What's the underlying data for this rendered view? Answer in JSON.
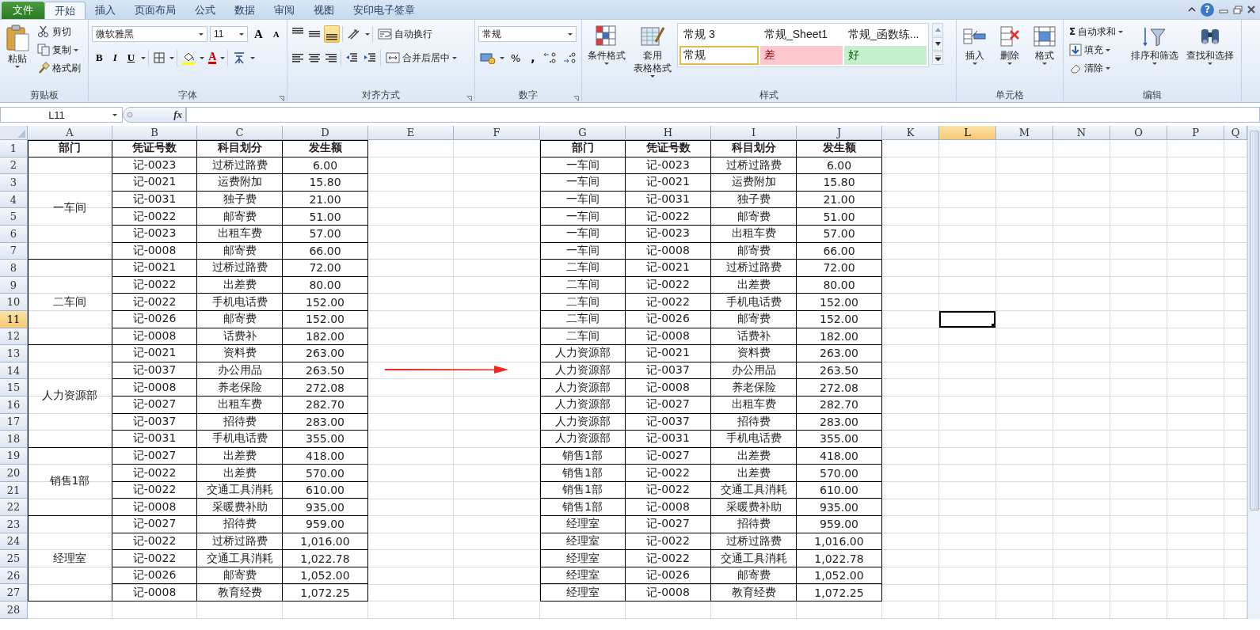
{
  "app_tabs": [
    {
      "label": "文件",
      "kind": "file",
      "selected": false
    },
    {
      "label": "开始",
      "kind": "tab",
      "selected": true
    },
    {
      "label": "插入",
      "kind": "tab",
      "selected": false
    },
    {
      "label": "页面布局",
      "kind": "tab",
      "selected": false
    },
    {
      "label": "公式",
      "kind": "tab",
      "selected": false
    },
    {
      "label": "数据",
      "kind": "tab",
      "selected": false
    },
    {
      "label": "审阅",
      "kind": "tab",
      "selected": false
    },
    {
      "label": "视图",
      "kind": "tab",
      "selected": false
    },
    {
      "label": "安印电子签章",
      "kind": "tab",
      "selected": false
    }
  ],
  "help": "?",
  "ribbon": {
    "clipboard": {
      "paste": "粘贴",
      "cut": "剪切",
      "copy": "复制",
      "format_painter": "格式刷",
      "label": "剪贴板"
    },
    "font": {
      "font_name": "微软雅黑",
      "font_size": "11",
      "grow": "A",
      "shrink": "A",
      "bold": "B",
      "italic": "I",
      "underline": "U",
      "font_color": "A",
      "label": "字体"
    },
    "alignment": {
      "vertical": [
        {
          "kind": "top",
          "selected": false
        },
        {
          "kind": "middle",
          "selected": false
        },
        {
          "kind": "bottom",
          "selected": true
        }
      ],
      "horizontal": [
        {
          "kind": "left",
          "selected": false
        },
        {
          "kind": "center",
          "selected": false
        },
        {
          "kind": "right",
          "selected": false
        }
      ],
      "wrap_text": "自动换行",
      "merge_center": "合并后居中",
      "label": "对齐方式"
    },
    "number": {
      "format": "常规",
      "percent": "%",
      "comma": ",",
      "label": "数字"
    },
    "styles": {
      "conditional": "条件格式",
      "table_format": [
        "套用",
        "表格格式"
      ],
      "gallery": [
        {
          "label": "常规 3",
          "kind": "plain",
          "selected": false
        },
        {
          "label": "常规_Sheet1",
          "kind": "plain",
          "selected": false
        },
        {
          "label": "常规_函数练...",
          "kind": "plain",
          "selected": false
        },
        {
          "label": "常规",
          "kind": "plain",
          "selected": true
        },
        {
          "label": "差",
          "kind": "bad",
          "selected": false
        },
        {
          "label": "好",
          "kind": "good",
          "selected": false
        }
      ],
      "label": "样式"
    },
    "cells": {
      "insert": "插入",
      "delete": "删除",
      "format": "格式",
      "label": "单元格"
    },
    "editing": {
      "sigma": "Σ",
      "autosum": "自动求和",
      "fill": "填充",
      "clear": "清除",
      "sort_filter": "排序和筛选",
      "find_select": "查找和选择",
      "label": "编辑"
    }
  },
  "name_box": "L11",
  "formula_label": "fx",
  "columns": [
    {
      "label": "A",
      "selected": false
    },
    {
      "label": "B",
      "selected": false
    },
    {
      "label": "C",
      "selected": false
    },
    {
      "label": "D",
      "selected": false
    },
    {
      "label": "E",
      "selected": false
    },
    {
      "label": "F",
      "selected": false
    },
    {
      "label": "G",
      "selected": false
    },
    {
      "label": "H",
      "selected": false
    },
    {
      "label": "I",
      "selected": false
    },
    {
      "label": "J",
      "selected": false
    },
    {
      "label": "K",
      "selected": false
    },
    {
      "label": "L",
      "selected": true
    },
    {
      "label": "M",
      "selected": false
    },
    {
      "label": "N",
      "selected": false
    },
    {
      "label": "O",
      "selected": false
    },
    {
      "label": "P",
      "selected": false
    },
    {
      "label": "Q",
      "selected": false
    }
  ],
  "rows": [
    {
      "label": "1",
      "selected": false
    },
    {
      "label": "2",
      "selected": false
    },
    {
      "label": "3",
      "selected": false
    },
    {
      "label": "4",
      "selected": false
    },
    {
      "label": "5",
      "selected": false
    },
    {
      "label": "6",
      "selected": false
    },
    {
      "label": "7",
      "selected": false
    },
    {
      "label": "8",
      "selected": false
    },
    {
      "label": "9",
      "selected": false
    },
    {
      "label": "10",
      "selected": false
    },
    {
      "label": "11",
      "selected": true
    },
    {
      "label": "12",
      "selected": false
    },
    {
      "label": "13",
      "selected": false
    },
    {
      "label": "14",
      "selected": false
    },
    {
      "label": "15",
      "selected": false
    },
    {
      "label": "16",
      "selected": false
    },
    {
      "label": "17",
      "selected": false
    },
    {
      "label": "18",
      "selected": false
    },
    {
      "label": "19",
      "selected": false
    },
    {
      "label": "20",
      "selected": false
    },
    {
      "label": "21",
      "selected": false
    },
    {
      "label": "22",
      "selected": false
    },
    {
      "label": "23",
      "selected": false
    },
    {
      "label": "24",
      "selected": false
    },
    {
      "label": "25",
      "selected": false
    },
    {
      "label": "26",
      "selected": false
    },
    {
      "label": "27",
      "selected": false
    },
    {
      "label": "28",
      "selected": false
    }
  ],
  "left_table": {
    "header": [
      "部门",
      "凭证号数",
      "科目划分",
      "发生额"
    ],
    "groups": [
      {
        "department": "一车间",
        "rows": [
          [
            "记-0023",
            "过桥过路费",
            "6.00"
          ],
          [
            "记-0021",
            "运费附加",
            "15.80"
          ],
          [
            "记-0031",
            "独子费",
            "21.00"
          ],
          [
            "记-0022",
            "邮寄费",
            "51.00"
          ],
          [
            "记-0023",
            "出租车费",
            "57.00"
          ],
          [
            "记-0008",
            "邮寄费",
            "66.00"
          ]
        ]
      },
      {
        "department": "二车间",
        "rows": [
          [
            "记-0021",
            "过桥过路费",
            "72.00"
          ],
          [
            "记-0022",
            "出差费",
            "80.00"
          ],
          [
            "记-0022",
            "手机电话费",
            "152.00"
          ],
          [
            "记-0026",
            "邮寄费",
            "152.00"
          ],
          [
            "记-0008",
            "话费补",
            "182.00"
          ]
        ]
      },
      {
        "department": "人力资源部",
        "rows": [
          [
            "记-0021",
            "资料费",
            "263.00"
          ],
          [
            "记-0037",
            "办公用品",
            "263.50"
          ],
          [
            "记-0008",
            "养老保险",
            "272.08"
          ],
          [
            "记-0027",
            "出租车费",
            "282.70"
          ],
          [
            "记-0037",
            "招待费",
            "283.00"
          ],
          [
            "记-0031",
            "手机电话费",
            "355.00"
          ]
        ]
      },
      {
        "department": "销售1部",
        "rows": [
          [
            "记-0027",
            "出差费",
            "418.00"
          ],
          [
            "记-0022",
            "出差费",
            "570.00"
          ],
          [
            "记-0022",
            "交通工具消耗",
            "610.00"
          ],
          [
            "记-0008",
            "采暖费补助",
            "935.00"
          ]
        ]
      },
      {
        "department": "经理室",
        "rows": [
          [
            "记-0027",
            "招待费",
            "959.00"
          ],
          [
            "记-0022",
            "过桥过路费",
            "1,016.00"
          ],
          [
            "记-0022",
            "交通工具消耗",
            "1,022.78"
          ],
          [
            "记-0026",
            "邮寄费",
            "1,052.00"
          ],
          [
            "记-0008",
            "教育经费",
            "1,072.25"
          ]
        ]
      }
    ]
  },
  "right_table": {
    "header": [
      "部门",
      "凭证号数",
      "科目划分",
      "发生额"
    ],
    "rows": [
      [
        "一车间",
        "记-0023",
        "过桥过路费",
        "6.00"
      ],
      [
        "一车间",
        "记-0021",
        "运费附加",
        "15.80"
      ],
      [
        "一车间",
        "记-0031",
        "独子费",
        "21.00"
      ],
      [
        "一车间",
        "记-0022",
        "邮寄费",
        "51.00"
      ],
      [
        "一车间",
        "记-0023",
        "出租车费",
        "57.00"
      ],
      [
        "一车间",
        "记-0008",
        "邮寄费",
        "66.00"
      ],
      [
        "二车间",
        "记-0021",
        "过桥过路费",
        "72.00"
      ],
      [
        "二车间",
        "记-0022",
        "出差费",
        "80.00"
      ],
      [
        "二车间",
        "记-0022",
        "手机电话费",
        "152.00"
      ],
      [
        "二车间",
        "记-0026",
        "邮寄费",
        "152.00"
      ],
      [
        "二车间",
        "记-0008",
        "话费补",
        "182.00"
      ],
      [
        "人力资源部",
        "记-0021",
        "资料费",
        "263.00"
      ],
      [
        "人力资源部",
        "记-0037",
        "办公用品",
        "263.50"
      ],
      [
        "人力资源部",
        "记-0008",
        "养老保险",
        "272.08"
      ],
      [
        "人力资源部",
        "记-0027",
        "出租车费",
        "282.70"
      ],
      [
        "人力资源部",
        "记-0037",
        "招待费",
        "283.00"
      ],
      [
        "人力资源部",
        "记-0031",
        "手机电话费",
        "355.00"
      ],
      [
        "销售1部",
        "记-0027",
        "出差费",
        "418.00"
      ],
      [
        "销售1部",
        "记-0022",
        "出差费",
        "570.00"
      ],
      [
        "销售1部",
        "记-0022",
        "交通工具消耗",
        "610.00"
      ],
      [
        "销售1部",
        "记-0008",
        "采暖费补助",
        "935.00"
      ],
      [
        "经理室",
        "记-0027",
        "招待费",
        "959.00"
      ],
      [
        "经理室",
        "记-0022",
        "过桥过路费",
        "1,016.00"
      ],
      [
        "经理室",
        "记-0022",
        "交通工具消耗",
        "1,022.78"
      ],
      [
        "经理室",
        "记-0026",
        "邮寄费",
        "1,052.00"
      ],
      [
        "经理室",
        "记-0008",
        "教育经费",
        "1,072.25"
      ]
    ]
  }
}
